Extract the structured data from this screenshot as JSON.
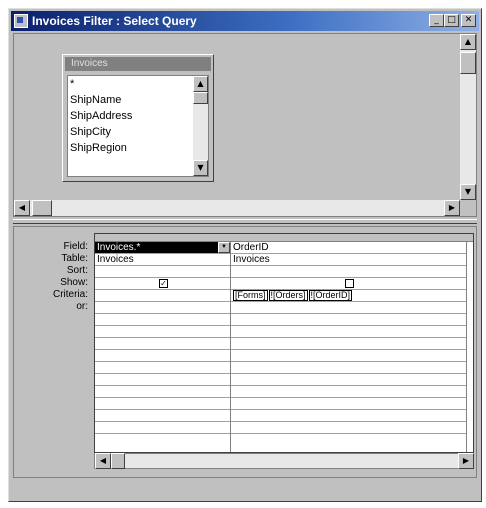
{
  "window": {
    "title": "Invoices Filter : Select Query"
  },
  "titlebar_buttons": {
    "minimize": "_",
    "maximize": "□",
    "close": "✕"
  },
  "field_list": {
    "title": "Invoices",
    "items": [
      "*",
      "ShipName",
      "ShipAddress",
      "ShipCity",
      "ShipRegion"
    ]
  },
  "row_labels": {
    "field": "Field:",
    "table": "Table:",
    "sort": "Sort:",
    "show": "Show:",
    "criteria": "Criteria:",
    "or": "or:"
  },
  "columns": [
    {
      "field": "Invoices.*",
      "table": "Invoices",
      "sort": "",
      "show": true,
      "criteria": []
    },
    {
      "field": "OrderID",
      "table": "Invoices",
      "sort": "",
      "show": false,
      "criteria": [
        "[Forms]",
        "![Orders]",
        "![OrderID]"
      ]
    }
  ],
  "icons": {
    "scroll_up": "▲",
    "scroll_down": "▼",
    "scroll_left": "◀",
    "scroll_right": "▶",
    "check": "✓"
  }
}
